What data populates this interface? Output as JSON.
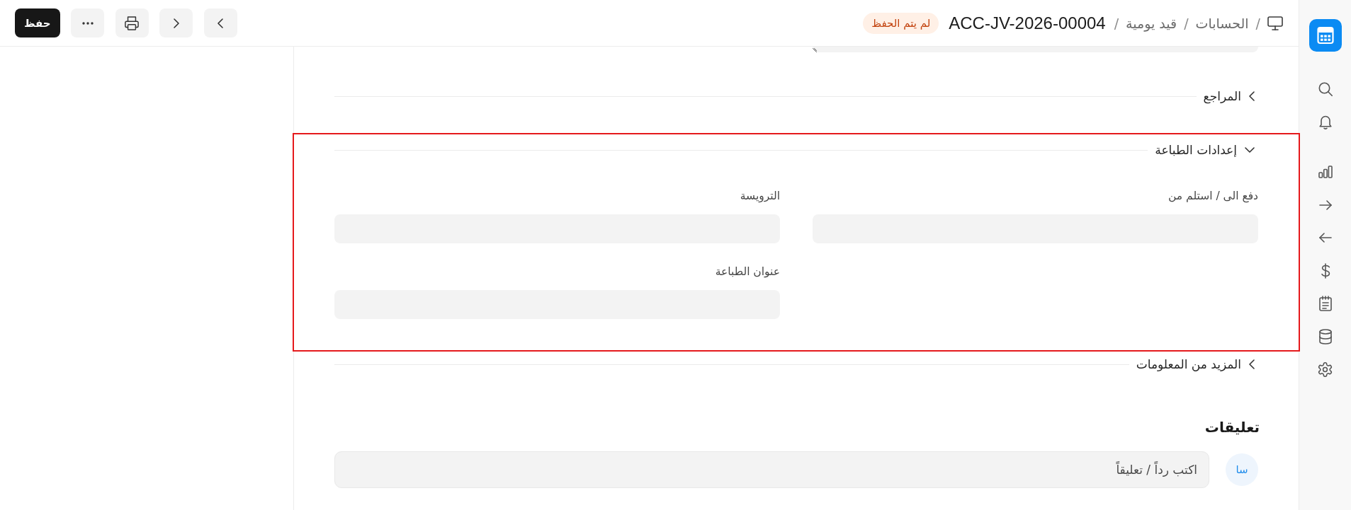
{
  "topbar": {
    "breadcrumb": [
      {
        "kind": "separator",
        "text": "/"
      },
      {
        "kind": "link",
        "text": "الحسابات"
      },
      {
        "kind": "separator",
        "text": "/"
      },
      {
        "kind": "link",
        "text": "قيد يومية"
      },
      {
        "kind": "separator",
        "text": "/"
      }
    ],
    "title": "ACC-JV-2026-00004",
    "status_badge": "لم يتم الحفظ",
    "save_button": "حفظ"
  },
  "form": {
    "sections": [
      {
        "title": "المراجع",
        "expanded": false,
        "highlighted": false
      },
      {
        "title": "إعدادات الطباعة",
        "expanded": true,
        "highlighted": true,
        "columns": [
          {
            "fields": [
              {
                "label": "دفع الى / استلم من"
              }
            ]
          },
          {
            "fields": [
              {
                "label": "الترويسة"
              },
              {
                "label": "عنوان الطباعة"
              }
            ]
          }
        ]
      },
      {
        "title": "المزيد من المعلومات",
        "expanded": false,
        "highlighted": false
      }
    ]
  },
  "comments": {
    "title": "تعليقات",
    "avatar": "سا",
    "placeholder": "اكتب رداً / تعليقاً"
  }
}
